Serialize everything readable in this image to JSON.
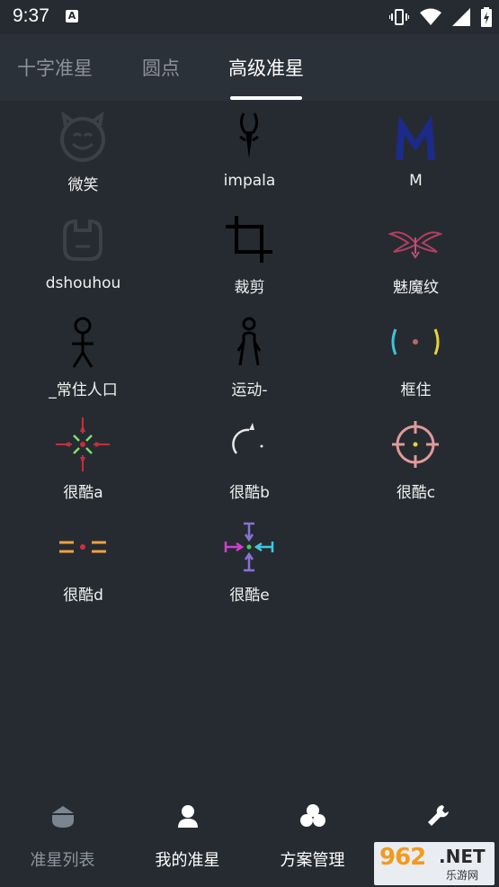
{
  "status": {
    "time": "9:37",
    "notif_letter": "A"
  },
  "tabs": [
    {
      "label": "十字准星",
      "active": false
    },
    {
      "label": "圆点",
      "active": false
    },
    {
      "label": "高级准星",
      "active": true
    }
  ],
  "items": [
    {
      "label": "微笑",
      "icon": "smiley-devil-icon"
    },
    {
      "label": "impala",
      "icon": "impala-antelope-icon"
    },
    {
      "label": "M",
      "icon": "blue-m-letter-icon"
    },
    {
      "label": "dshouhou",
      "icon": "robot-face-icon"
    },
    {
      "label": "裁剪",
      "icon": "crop-icon"
    },
    {
      "label": "魅魔纹",
      "icon": "succubus-tattoo-icon"
    },
    {
      "label": "_常住人口",
      "icon": "stick-figure-icon"
    },
    {
      "label": "运动-",
      "icon": "running-figure-icon"
    },
    {
      "label": "框住",
      "icon": "bracket-frame-icon"
    },
    {
      "label": "很酷a",
      "icon": "crosshair-red-green-icon"
    },
    {
      "label": "很酷b",
      "icon": "crosshair-arc-icon"
    },
    {
      "label": "很酷c",
      "icon": "crosshair-circle-pink-icon"
    },
    {
      "label": "很酷d",
      "icon": "crosshair-dashes-orange-icon"
    },
    {
      "label": "很酷e",
      "icon": "crosshair-arrows-color-icon"
    }
  ],
  "nav": [
    {
      "label": "准星列表",
      "icon": "crosshair-list-icon",
      "active": true
    },
    {
      "label": "我的准星",
      "icon": "user-icon",
      "active": false
    },
    {
      "label": "方案管理",
      "icon": "cluster-icon",
      "active": false
    },
    {
      "label": "设置",
      "icon": "wrench-icon",
      "active": false
    }
  ],
  "watermark": {
    "number": "962",
    "suffix": ".NET",
    "sub": "乐游网"
  },
  "colors": {
    "background": "#262b31",
    "tabbar": "#2b3138",
    "active_text": "#ffffff",
    "inactive_text": "#8c9299"
  }
}
